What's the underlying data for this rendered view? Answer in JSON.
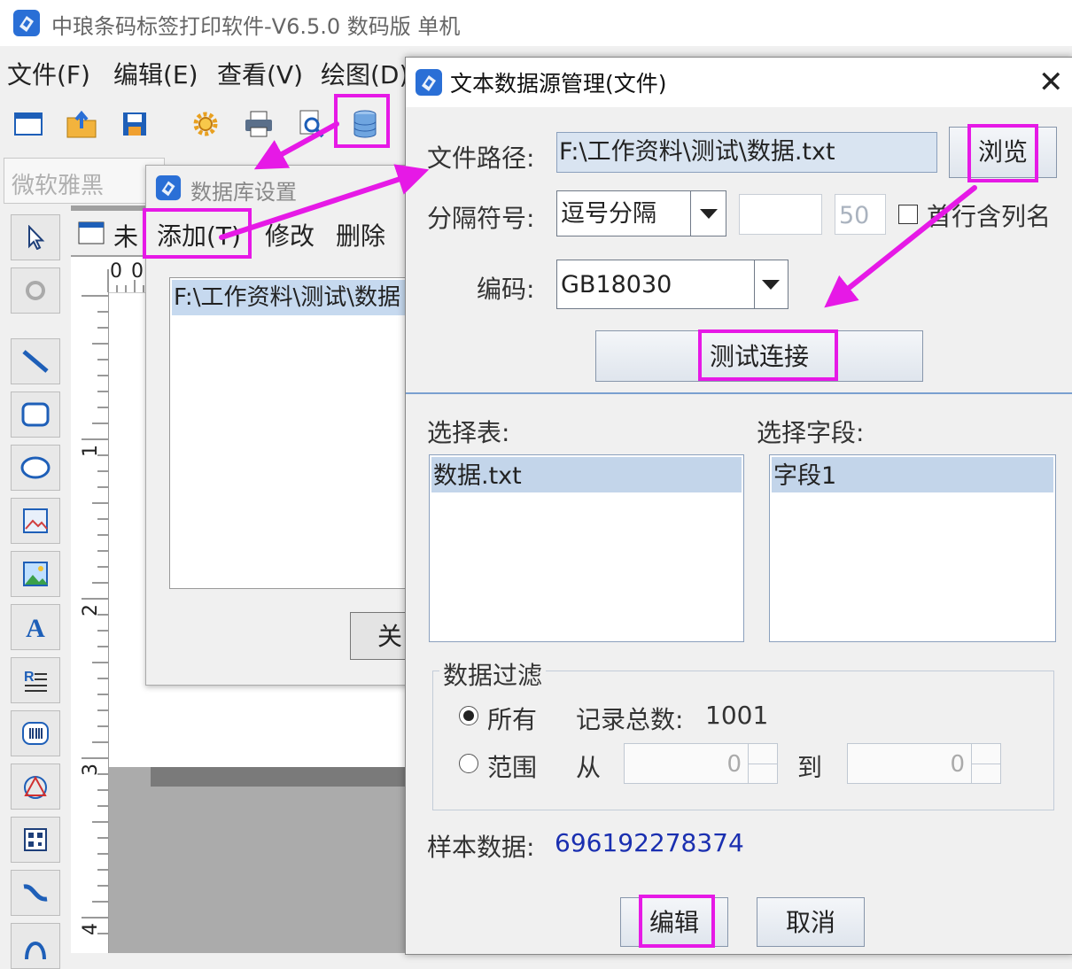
{
  "app": {
    "title": "中琅条码标签打印软件-V6.5.0 数码版 单机",
    "menu": [
      "文件(F)",
      "编辑(E)",
      "查看(V)",
      "绘图(D)"
    ],
    "font_name": "微软雅黑",
    "doc_tab": "未",
    "ruler_origin": "0",
    "ruler_marks": [
      "1",
      "2",
      "3",
      "4"
    ]
  },
  "db_dialog": {
    "title": "数据库设置",
    "add_label": "添加(T)",
    "edit_label": "修改",
    "delete_label": "删除",
    "list_item": "F:\\工作资料\\测试\\数据",
    "close_label": "关"
  },
  "ds_dialog": {
    "title": "文本数据源管理(文件)",
    "close_glyph": "✕",
    "file_path_label": "文件路径:",
    "file_path_value": "F:\\工作资料\\测试\\数据.txt",
    "browse_label": "浏览",
    "separator_label": "分隔符号:",
    "separator_value": "逗号分隔",
    "separator_custom": "",
    "column_width": "50",
    "first_row_header": "首行含列名",
    "encoding_label": "编码:",
    "encoding_value": "GB18030",
    "test_connection_label": "测试连接",
    "select_table_label": "选择表:",
    "tables": [
      "数据.txt"
    ],
    "select_field_label": "选择字段:",
    "fields": [
      "字段1"
    ],
    "filter_group_label": "数据过滤",
    "all_label": "所有",
    "total_label": "记录总数:",
    "total_value": "1001",
    "range_label": "范围",
    "from_label": "从",
    "from_value": "0",
    "to_label": "到",
    "to_value": "0",
    "sample_label": "样本数据:",
    "sample_value": "696192278374",
    "edit_label": "编辑",
    "cancel_label": "取消"
  },
  "colors": {
    "highlight": "#e619e6",
    "selection": "#c3d5ea",
    "sample_text": "#1a2fb0"
  }
}
